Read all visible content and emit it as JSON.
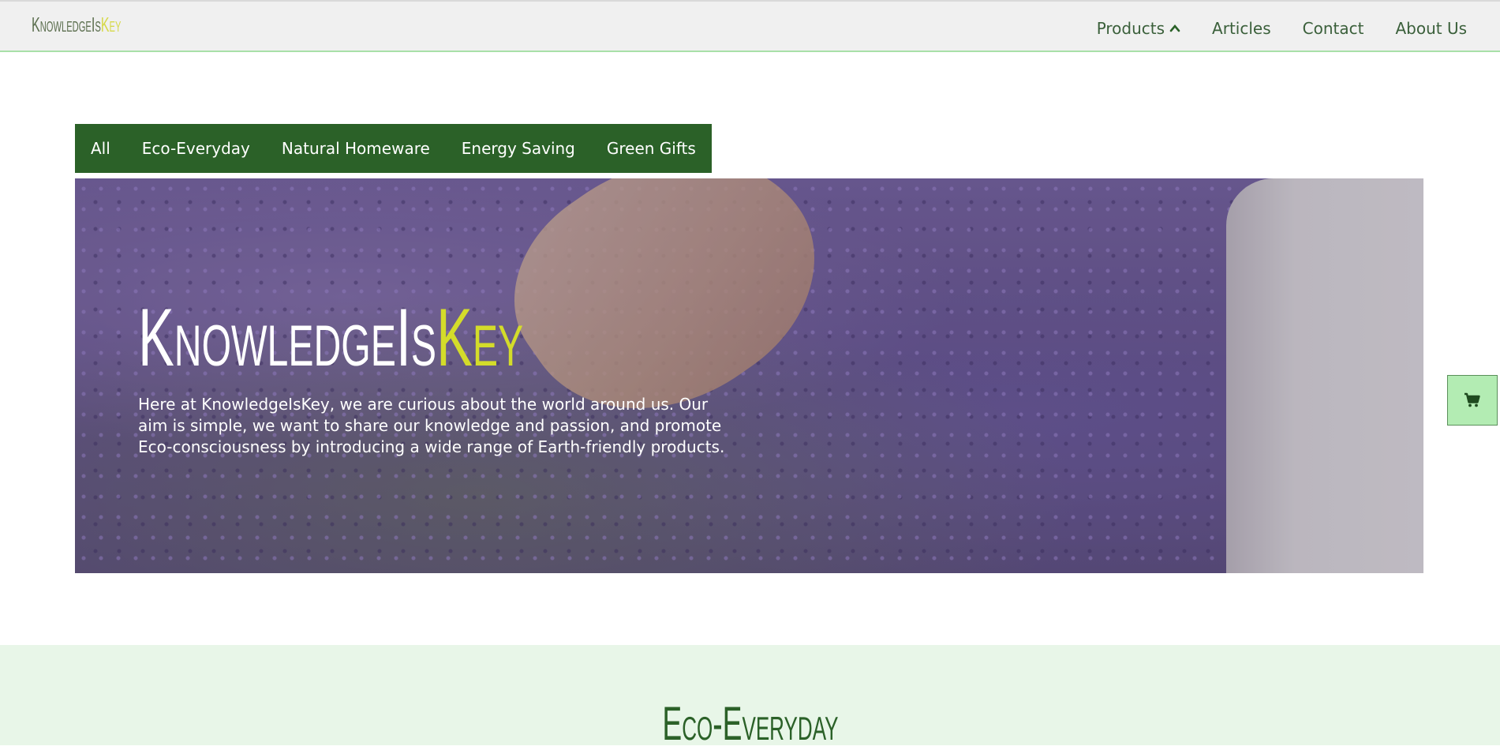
{
  "header": {
    "logo_part1": "KnowledgeIs",
    "logo_part2": "Key",
    "nav": [
      {
        "label": "Products",
        "icon": "chevron-up-icon"
      },
      {
        "label": "Articles"
      },
      {
        "label": "Contact"
      },
      {
        "label": "About Us"
      }
    ]
  },
  "categories": [
    "All",
    "Eco-Everyday",
    "Natural Homeware",
    "Energy Saving",
    "Green Gifts"
  ],
  "hero": {
    "title_part1": "KnowledgeIs",
    "title_part2": "Key",
    "text": "Here at KnowledgeIsKey, we are curious about the world around us. Our aim is simple, we want to share our knowledge and passion, and promote Eco-consciousness by introducing a wide range of Earth-friendly products."
  },
  "cart": {
    "icon": "shopping-cart-icon"
  },
  "section": {
    "title": "Eco-Everyday"
  },
  "colors": {
    "brand_green": "#2b6128",
    "accent_yellow": "#d4dc2a",
    "cart_bg": "#b3ecb3",
    "section_bg": "#e8f6e8"
  }
}
